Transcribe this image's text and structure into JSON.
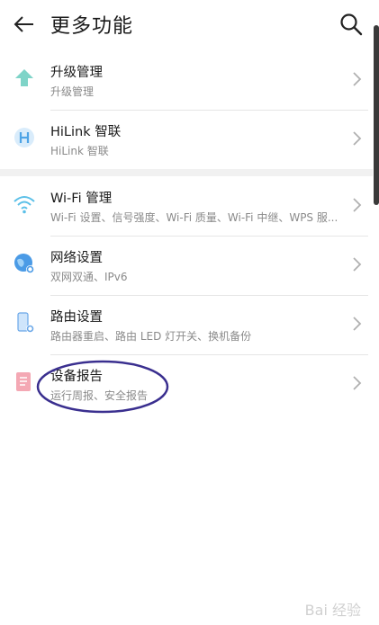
{
  "header": {
    "title": "更多功能"
  },
  "sections": [
    {
      "items": [
        {
          "label": "升级管理",
          "subtitle": "升级管理",
          "icon": "upgrade-arrow-icon",
          "color": "#6fd0c4"
        },
        {
          "label": "HiLink 智联",
          "subtitle": "HiLink 智联",
          "icon": "hilink-icon",
          "color": "#4ea4e6"
        }
      ]
    },
    {
      "items": [
        {
          "label": "Wi-Fi 管理",
          "subtitle": "Wi-Fi 设置、信号强度、Wi-Fi 质量、Wi-Fi 中继、WPS 服...",
          "icon": "wifi-icon",
          "color": "#5bc0e8"
        },
        {
          "label": "网络设置",
          "subtitle": "双网双通、IPv6",
          "icon": "globe-gear-icon",
          "color": "#3c8fe0"
        },
        {
          "label": "路由设置",
          "subtitle": "路由器重启、路由 LED 灯开关、换机备份",
          "icon": "router-gear-icon",
          "color": "#6ba8e8"
        },
        {
          "label": "设备报告",
          "subtitle": "运行周报、安全报告",
          "icon": "report-doc-icon",
          "color": "#f08a9a"
        }
      ]
    }
  ],
  "watermark": "Bai 经验"
}
